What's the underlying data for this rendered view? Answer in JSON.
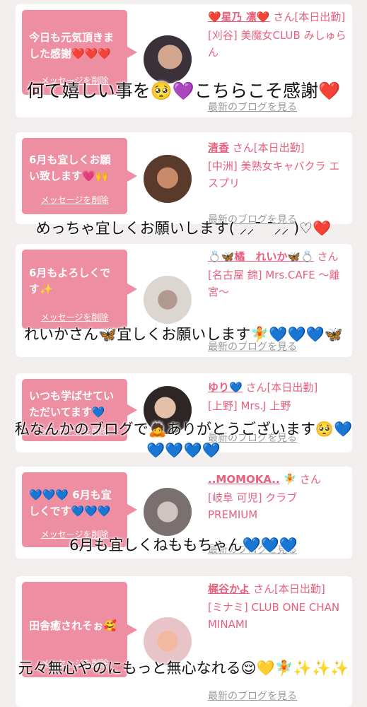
{
  "cards": [
    {
      "message": "今日も元気頂きました感謝❤️❤️❤️",
      "delete_label": "メッセージを削除",
      "name": "❤️星乃 凛❤️",
      "san": "さん[本日出勤]",
      "shop": "[刈谷] 美魔女CLUB みしゅらん",
      "blog": "最新のブログを見る",
      "avatar_colors": [
        "#3a3238",
        "#c8a38e"
      ]
    },
    {
      "message": "6月も宜しくお願い致します💗🙌",
      "delete_label": "メッセージを削除",
      "name": "清香",
      "san": "さん[本日出勤]",
      "shop": "[中洲] 美熟女キャバクラ エスプリ",
      "blog": "最新のブログを見る",
      "avatar_colors": [
        "#5a3a2a",
        "#c98a6a"
      ]
    },
    {
      "message": "6月もよろしくです✨",
      "delete_label": "メッセージを削除",
      "name": "💍🦋橘　れいか🦋💍",
      "san": "さん",
      "shop": "[名古屋 錦] Mrs.CAFE ～離宮～",
      "blog": "最新のブログを見る",
      "avatar_colors": [
        "#d9d4cf",
        "#8a7a70"
      ]
    },
    {
      "message": "いつも学ばせていただいてます💙",
      "delete_label": "メッセージを削除",
      "name": "ゆり💙",
      "san": "さん[本日出勤]",
      "shop": "[上野] Mrs.J 上野",
      "blog": "最新のブログを見る",
      "avatar_colors": [
        "#2e2624",
        "#e4c0a8"
      ]
    },
    {
      "message": "💙💙💙 6月も宜しくです💙💙💙",
      "delete_label": "メッセージを削除",
      "name": "..MOMOKA..",
      "san": "🧚 さん",
      "shop": "[岐阜 可児] クラブPREMIUM",
      "blog": "最新のブログを見る",
      "avatar_colors": [
        "#7a7070",
        "#cfc4c0"
      ]
    },
    {
      "message": "田舎癒されそぉ🥰",
      "delete_label": "メッセージを削除",
      "name": "梶谷かよ",
      "san": "さん[本日出勤]",
      "shop": "[ミナミ] CLUB ONE CHAN MINAMI",
      "blog": "最新のブログを見る",
      "avatar_colors": [
        "#e8c4c8",
        "#f3b9a0"
      ]
    }
  ],
  "overlays": [
    "何て嬉しい事を🥺💜こちらこそ感謝❤️",
    "めっちゃ宜しくお願いします( ⸝⸝¯ ¯⸝⸝ )♡❤️",
    "れいかさん🦋宜しくお願いします🧚💙💙💙🦋",
    "私なんかのブログで🙇ありがとうございます🥺💙💙💙💙💙",
    "6月も宜しくねももちゃん💙💙💙",
    "元々無心やのにもっと無心なれる😌💛🧚✨✨✨"
  ],
  "colors": {
    "accent": "#e9607f",
    "bubble": "#ee8ea2",
    "background": "#f2eeee"
  }
}
